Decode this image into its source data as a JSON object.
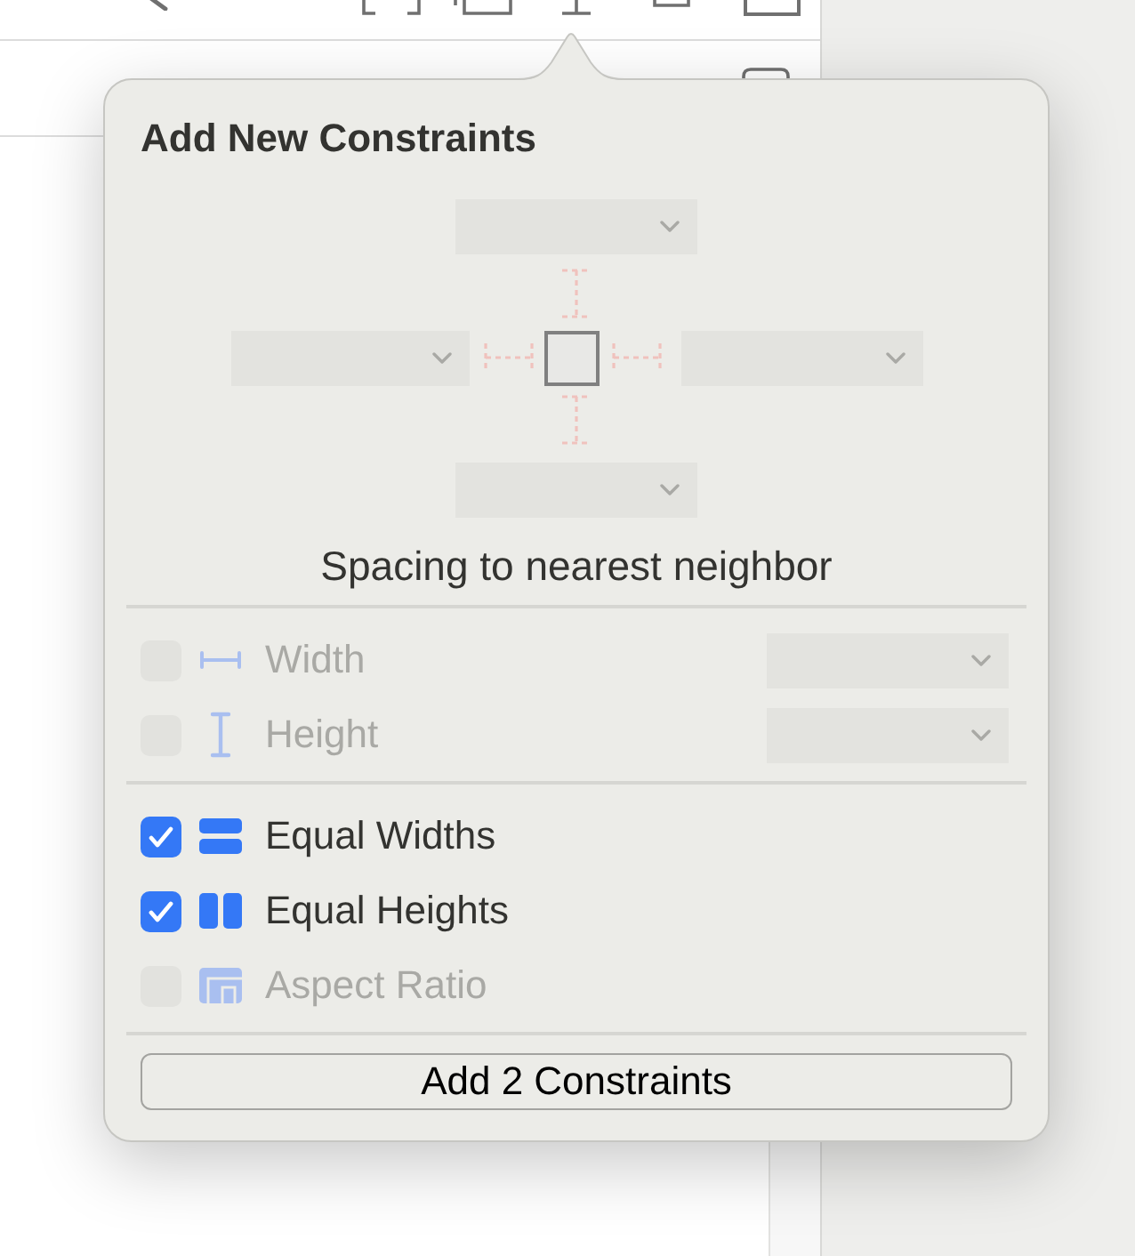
{
  "popover": {
    "title": "Add New Constraints",
    "spacing": {
      "top": {
        "disabled": true,
        "pinned": false
      },
      "left": {
        "disabled": true,
        "pinned": false
      },
      "right": {
        "disabled": true,
        "pinned": false
      },
      "bottom": {
        "disabled": true,
        "pinned": false
      },
      "caption": "Spacing to nearest neighbor"
    },
    "size_constraints": [
      {
        "kind": "width",
        "label": "Width",
        "checked": false,
        "disabled": true
      },
      {
        "kind": "height",
        "label": "Height",
        "checked": false,
        "disabled": true
      }
    ],
    "ratio_constraints": [
      {
        "kind": "equal_widths",
        "label": "Equal Widths",
        "checked": true,
        "disabled": false
      },
      {
        "kind": "equal_heights",
        "label": "Equal Heights",
        "checked": true,
        "disabled": false
      },
      {
        "kind": "aspect_ratio",
        "label": "Aspect Ratio",
        "checked": false,
        "disabled": true
      }
    ],
    "button": {
      "label": "Add 2 Constraints"
    }
  }
}
